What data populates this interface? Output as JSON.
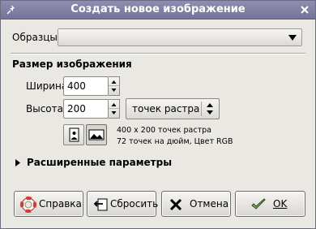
{
  "window": {
    "title": "Создать новое изображение"
  },
  "templates": {
    "label": "Образцы:",
    "value": ""
  },
  "size_section": {
    "heading": "Размер изображения"
  },
  "width": {
    "label": "Ширина:",
    "value": "400"
  },
  "height": {
    "label": "Высота:",
    "value": "200"
  },
  "units": {
    "selected": "точек растра"
  },
  "info": {
    "dimensions": "400 x 200 точек растра",
    "resolution": "72 точек на дюйм, Цвет RGB"
  },
  "advanced": {
    "label": "Расширенные параметры",
    "expanded": false
  },
  "buttons": {
    "help": "Справка",
    "reset": "Сбросить",
    "cancel": "Отмена",
    "ok": "OK"
  },
  "colors": {
    "titlebar": "#75739a",
    "dialog_bg": "#eae8e3"
  }
}
